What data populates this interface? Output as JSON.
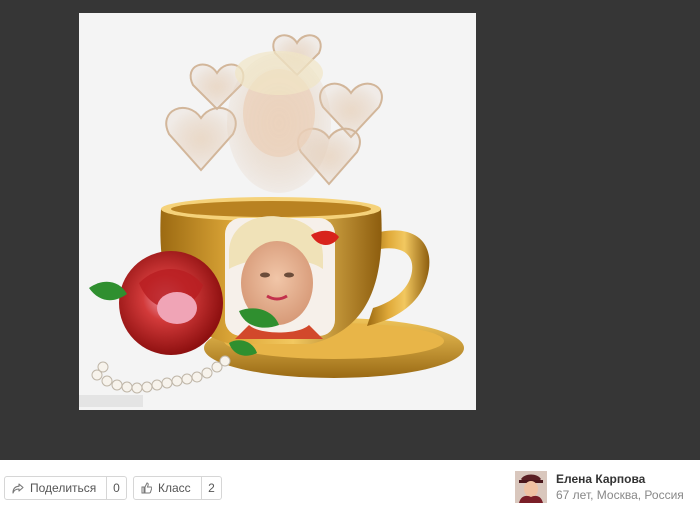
{
  "toolbar": {
    "share_label": "Поделиться",
    "share_count": "0",
    "like_label": "Класс",
    "like_count": "2"
  },
  "author": {
    "name": "Елена Карпова",
    "meta": "67 лет, Москва, Россия"
  },
  "icons": {
    "share": "share-arrow-icon",
    "like": "thumbs-up-icon"
  },
  "colors": {
    "background": "#363636",
    "bar": "#ffffff",
    "cup_gold": "#c8911f"
  }
}
